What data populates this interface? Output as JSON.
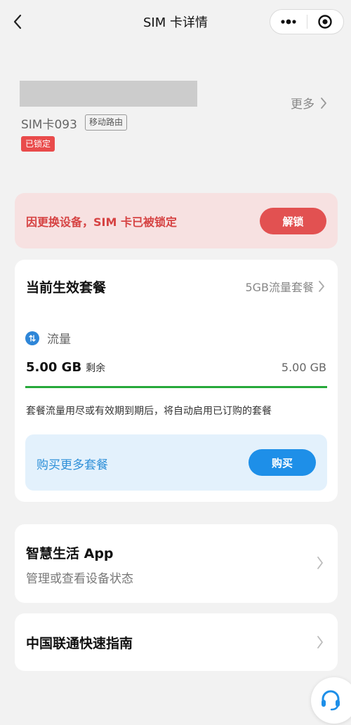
{
  "nav": {
    "title": "SIM 卡详情",
    "back_icon": "chevron-left-icon",
    "menu_icon": "more-dots-icon",
    "close_icon": "target-circle-icon"
  },
  "sim": {
    "name": "SIM卡093",
    "mode_tag": "移动路由",
    "status_tag": "已锁定",
    "more_label": "更多"
  },
  "alert": {
    "message": "因更换设备，SIM 卡已被锁定",
    "unlock_label": "解锁",
    "color": "#e25151"
  },
  "plan": {
    "title": "当前生效套餐",
    "plan_name": "5GB流量套餐",
    "traffic_label": "流量",
    "remaining_value": "5.00 GB",
    "remaining_unit": "剩余",
    "total_value": "5.00 GB",
    "progress_percent": 100,
    "note": "套餐流量用尽或有效期到期后，将自动启用已订购的套餐",
    "buy_text": "购买更多套餐",
    "buy_label": "购买",
    "accent_color": "#1e8fe8",
    "progress_color": "#26a93a"
  },
  "app_card": {
    "title": "智慧生活 App",
    "subtitle": "管理或查看设备状态"
  },
  "guide_card": {
    "title": "中国联通快速指南"
  },
  "support": {
    "icon": "headset-icon"
  }
}
